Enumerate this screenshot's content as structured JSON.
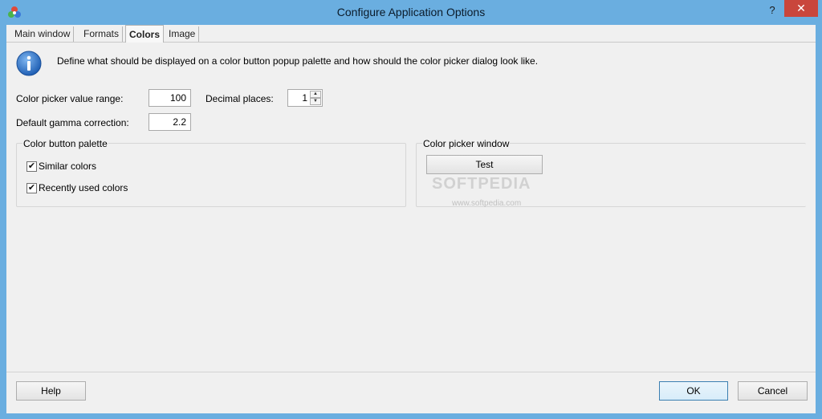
{
  "window": {
    "title": "Configure Application Options",
    "help_glyph": "?",
    "close_glyph": "✕"
  },
  "tabs": [
    {
      "label": "Main window",
      "active": false
    },
    {
      "label": "Formats",
      "active": false
    },
    {
      "label": "Colors",
      "active": true
    },
    {
      "label": "Image",
      "active": false
    }
  ],
  "info": {
    "icon": "info-icon",
    "text": "Define what should be displayed on a color button popup palette and how should the color picker dialog look like."
  },
  "settings": {
    "value_range_label": "Color picker value range:",
    "value_range": "100",
    "decimal_label": "Decimal places:",
    "decimal_value": "1",
    "gamma_label": "Default gamma correction:",
    "gamma_value": "2.2"
  },
  "palette_group": {
    "title": "Color button palette",
    "items": [
      {
        "label": "Similar colors",
        "checked": true
      },
      {
        "label": "Recently used colors",
        "checked": true
      }
    ]
  },
  "picker_group": {
    "title": "Color picker window",
    "test_label": "Test"
  },
  "watermark": {
    "brand": "SOFTPEDIA",
    "url": "www.softpedia.com"
  },
  "footer": {
    "help_label": "Help",
    "ok_label": "OK",
    "cancel_label": "Cancel"
  },
  "colors": {
    "titlebar": "#6aaee0",
    "close_button": "#c9463c",
    "dialog_bg": "#f0f0f0",
    "info_icon": "#1f5fb4"
  }
}
